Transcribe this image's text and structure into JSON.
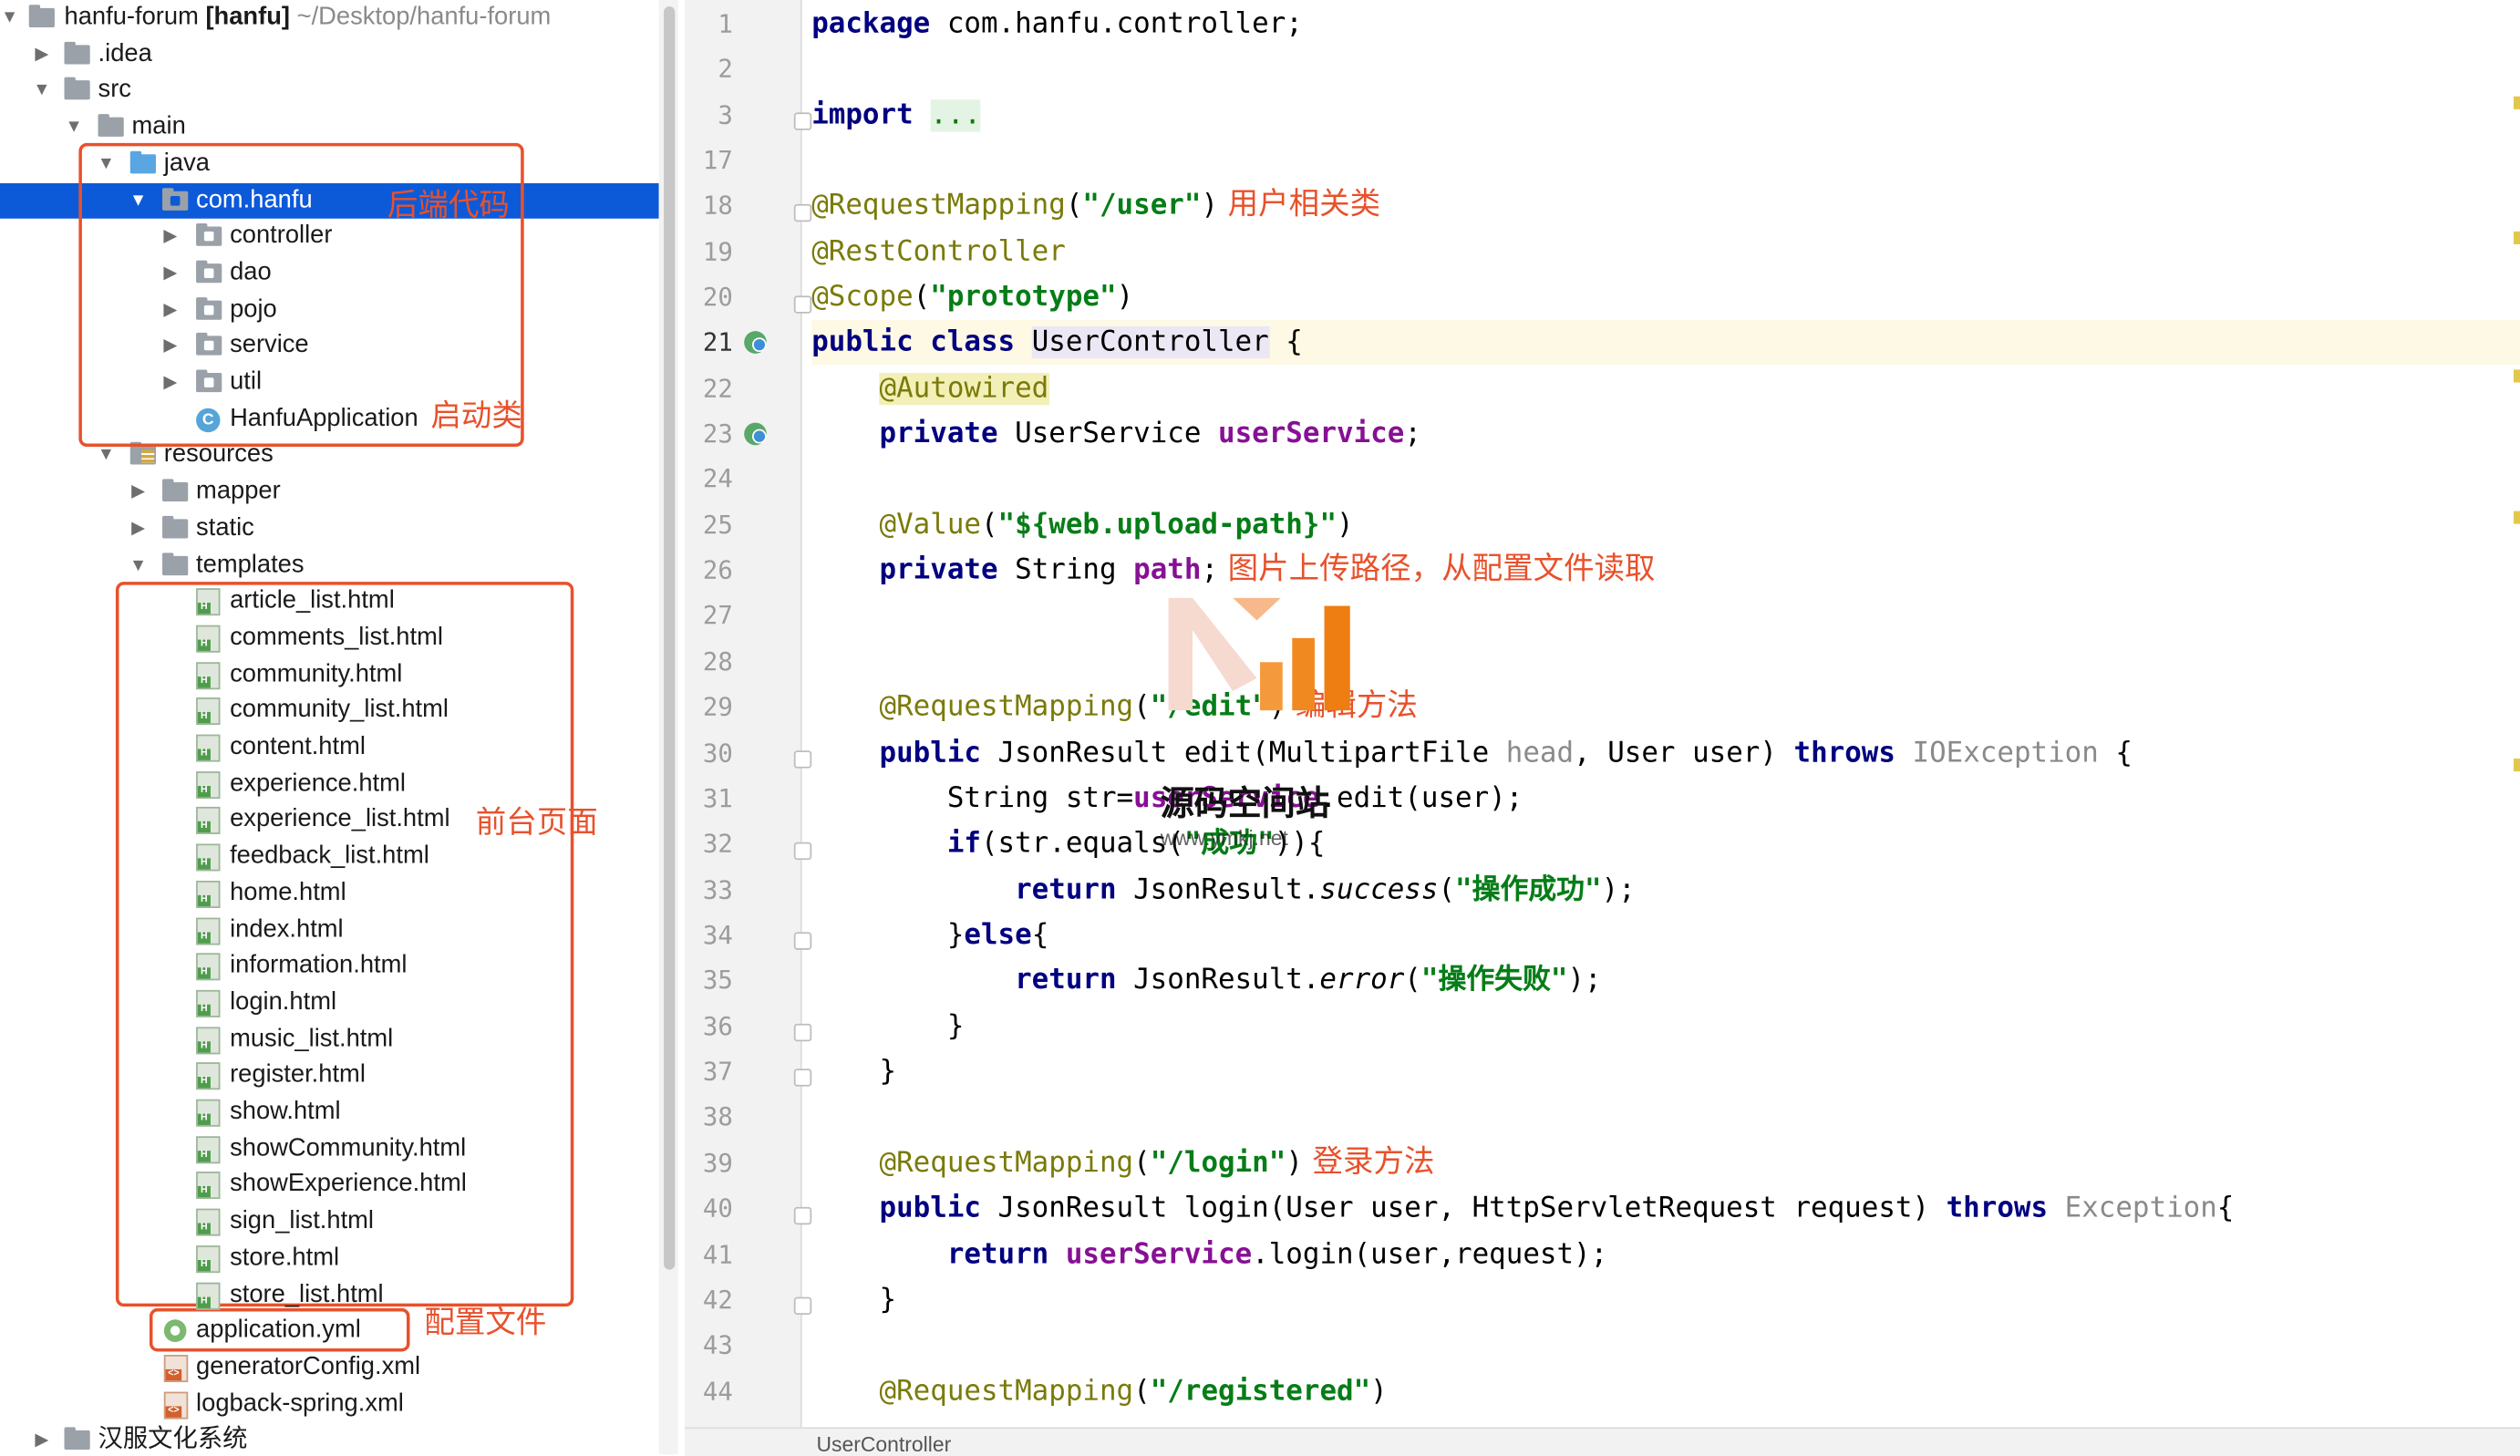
{
  "project": {
    "name": "hanfu-forum",
    "module": "[hanfu]",
    "path": "~/Desktop/hanfu-forum",
    "idea": ".idea",
    "src": "src",
    "main": "main",
    "java": "java",
    "package": "com.hanfu",
    "packages": [
      "controller",
      "dao",
      "pojo",
      "service",
      "util"
    ],
    "app_class": "HanfuApplication",
    "resources": "resources",
    "resource_dirs": [
      "mapper",
      "static"
    ],
    "templates": "templates",
    "template_files": [
      "article_list.html",
      "comments_list.html",
      "community.html",
      "community_list.html",
      "content.html",
      "experience.html",
      "experience_list.html",
      "feedback_list.html",
      "home.html",
      "index.html",
      "information.html",
      "login.html",
      "music_list.html",
      "register.html",
      "show.html",
      "showCommunity.html",
      "showExperience.html",
      "sign_list.html",
      "store.html",
      "store_list.html"
    ],
    "config_file": "application.yml",
    "xml_files": [
      "generatorConfig.xml",
      "logback-spring.xml"
    ],
    "bottom_folder": "汉服文化系统"
  },
  "annotations": {
    "backend": "后端代码",
    "startup": "启动类",
    "frontend": "前台页面",
    "config": "配置文件",
    "user_class": "用户相关类",
    "upload_path": "图片上传路径，从配置文件读取",
    "edit_method": "编辑方法",
    "login_method": "登录方法"
  },
  "editor": {
    "line_numbers": [
      "1",
      "2",
      "3",
      "17",
      "18",
      "19",
      "20",
      "21",
      "22",
      "23",
      "24",
      "25",
      "26",
      "27",
      "28",
      "29",
      "30",
      "31",
      "32",
      "33",
      "34",
      "35",
      "36",
      "37",
      "38",
      "39",
      "40",
      "41",
      "42",
      "43",
      "44"
    ],
    "current_line": "21",
    "breadcrumb": "UserController",
    "code": {
      "l1_kw": "package",
      "l1_rest": " com.hanfu.controller;",
      "l3_kw": "import",
      "l3_dots": "...",
      "l18_ann": "@RequestMapping",
      "l18_str": "\"/user\"",
      "l19_ann": "@RestController",
      "l20_ann": "@Scope",
      "l20_str": "\"prototype\"",
      "l21_kw": "public class",
      "l21_cls": "UserController",
      "l21_rest": " {",
      "l22_ann": "@Autowired",
      "l23_kw": "private",
      "l23_type": " UserService ",
      "l23_fld": "userService",
      "l23_end": ";",
      "l25_ann": "@Value",
      "l25_str": "\"${web.upload-path}\"",
      "l26_kw": "private",
      "l26_type": " String ",
      "l26_fld": "path",
      "l26_end": ";",
      "l29_ann": "@RequestMapping",
      "l29_str": "\"/edit\"",
      "l30_kw": "public",
      "l30_a": " JsonResult edit(MultipartFile ",
      "l30_param": "head",
      "l30_b": ", User user) ",
      "l30_kw2": "throws",
      "l30_exc": " IOException",
      "l30_end": " {",
      "l31_a": "String str=",
      "l31_fld": "userService",
      "l31_b": ".edit(user);",
      "l32_kw": "if",
      "l32_a": "(str.equals(",
      "l32_str": "\"成功\"",
      "l32_b": ")){",
      "l33_kw": "return",
      "l33_a": " JsonResult.",
      "l33_m": "success",
      "l33_str": "\"操作成功\"",
      "l34_a": "}",
      "l34_kw": "else",
      "l34_b": "{",
      "l35_kw": "return",
      "l35_a": " JsonResult.",
      "l35_m": "error",
      "l35_str": "\"操作失败\"",
      "l36": "}",
      "l37": "}",
      "l39_ann": "@RequestMapping",
      "l39_str": "\"/login\"",
      "l40_kw": "public",
      "l40_a": " JsonResult login(User user, HttpServletRequest request) ",
      "l40_kw2": "throws",
      "l40_exc": " Exception",
      "l40_end": "{",
      "l41_kw": "return",
      "l41_fld": "userService",
      "l41_a": ".login(user,request);",
      "l42": "}",
      "l44_ann": "@RequestMapping",
      "l44_str": "\"/registered\""
    }
  },
  "watermark": {
    "text": "源码空间站",
    "sub": "www.ymkj.net"
  },
  "colors": {
    "selection": "#0d5ad9",
    "annotation": "#e8512b",
    "keyword": "#000080",
    "string": "#067d17",
    "field": "#871094"
  }
}
